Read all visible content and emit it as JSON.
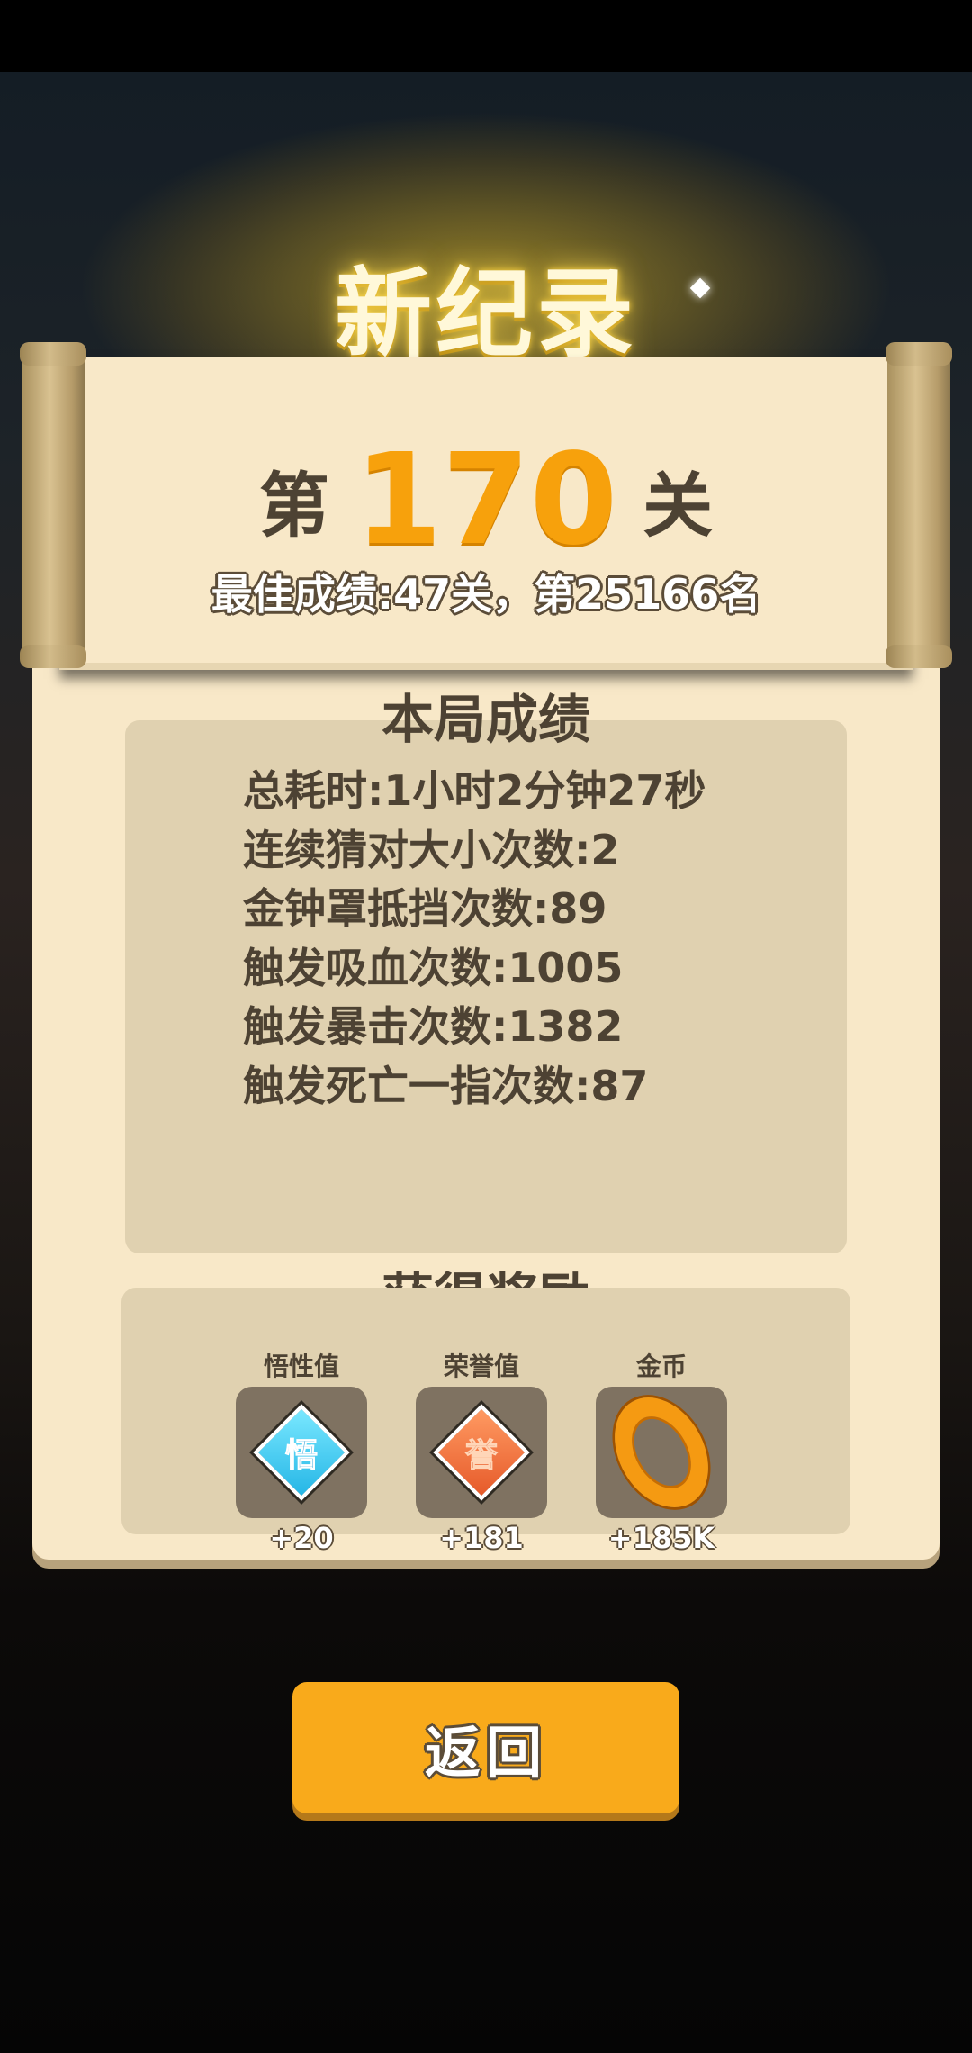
{
  "header": {
    "title": "新纪录"
  },
  "level": {
    "prefix": "第",
    "number": "170",
    "suffix": "关"
  },
  "best_result": "最佳成绩:47关，第25166名",
  "stats": {
    "title": "本局成绩",
    "items": [
      "总耗时:1小时2分钟27秒",
      "连续猜对大小次数:2",
      "金钟罩抵挡次数:89",
      "触发吸血次数:1005",
      "触发暴击次数:1382",
      "触发死亡一指次数:87"
    ]
  },
  "rewards": {
    "title": "获得奖励",
    "items": [
      {
        "name": "悟性值",
        "glyph": "悟",
        "amount": "+20",
        "icon": "comprehension-diamond-icon",
        "color": "#2ab8e8"
      },
      {
        "name": "荣誉值",
        "glyph": "誉",
        "amount": "+181",
        "icon": "honor-diamond-icon",
        "color": "#ee6a33"
      },
      {
        "name": "金币",
        "amount": "+185K",
        "icon": "gold-coin-icon",
        "color": "#f59a12"
      }
    ]
  },
  "actions": {
    "back_label": "返回"
  },
  "colors": {
    "accent": "#f9aa1b",
    "parchment": "#f8e8c8",
    "panel": "#e0d1b0",
    "text": "#4d4233"
  }
}
